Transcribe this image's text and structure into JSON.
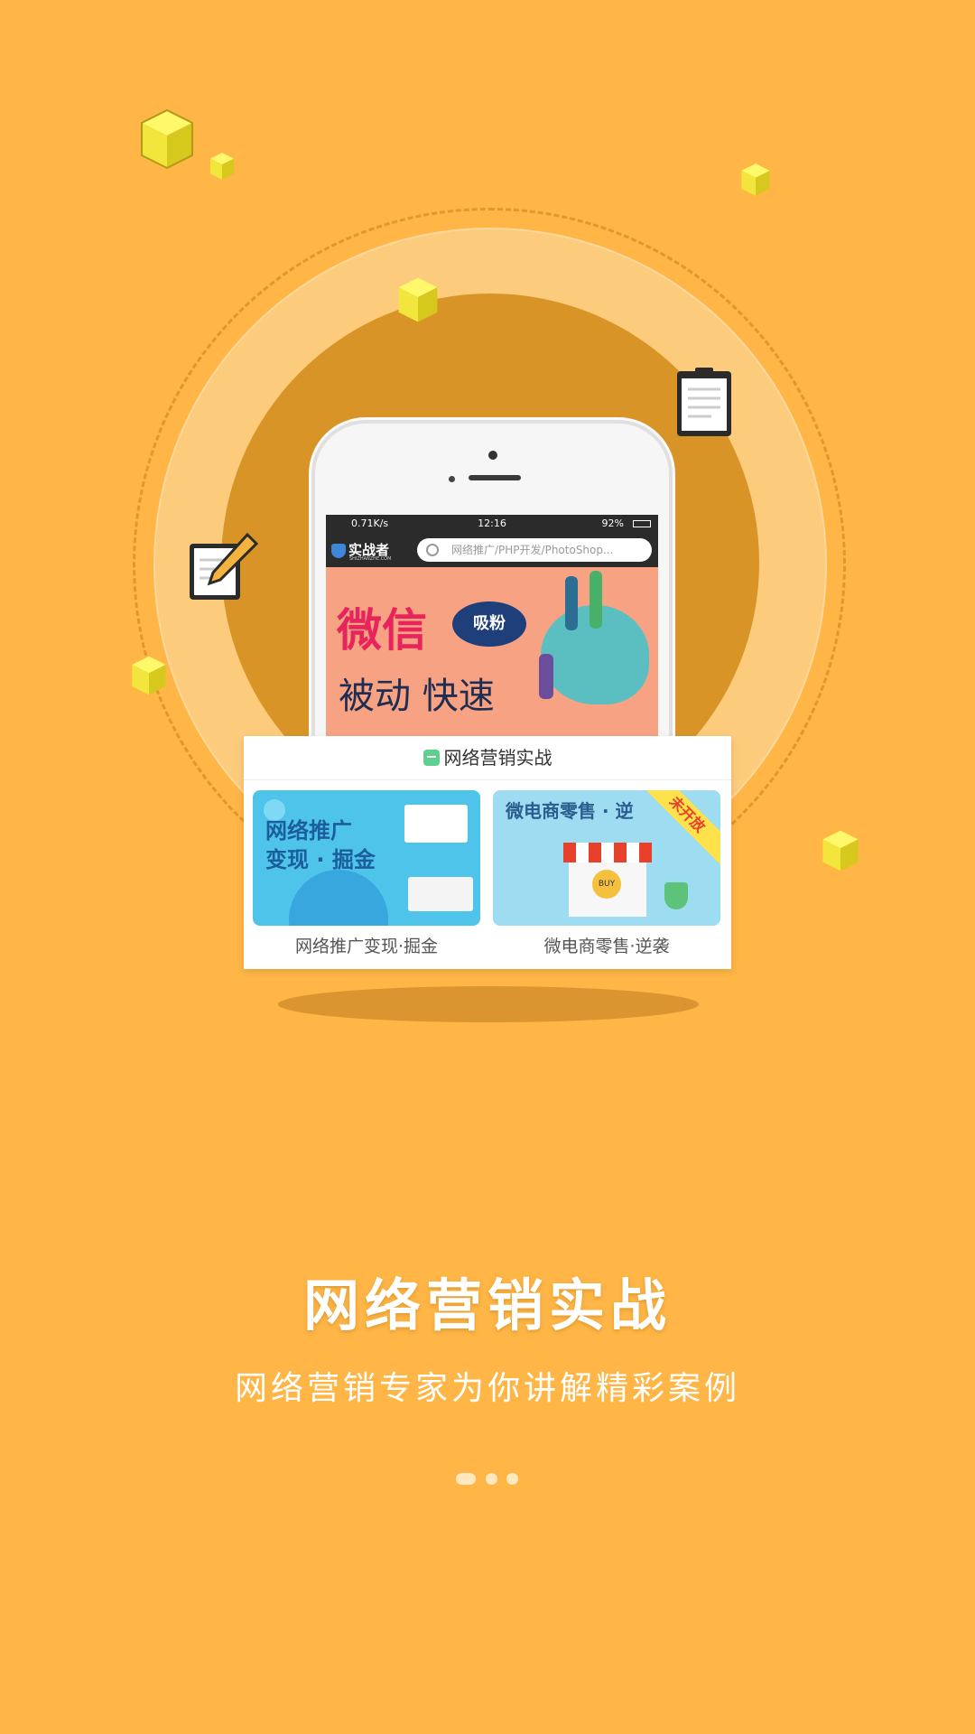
{
  "phone": {
    "status": {
      "left": "0.71K/s",
      "time": "12:16",
      "battery": "92%"
    },
    "app_name": "实战者",
    "app_domain": "SHIZHANZHE.COM",
    "search_placeholder": "网络推广/PHP开发/PhotoShop...",
    "banner": {
      "line1": "微信",
      "badge": "吸粉",
      "line2": "被动 快速"
    }
  },
  "card": {
    "title": "网络营销实战",
    "items": [
      {
        "thumb_text_1": "网络推广",
        "thumb_text_2": "变现 · 掘金",
        "caption": "网络推广变现·掘金"
      },
      {
        "thumb_text_1": "微电商零售 · 逆",
        "ribbon": "未开放",
        "caption": "微电商零售·逆袭"
      }
    ]
  },
  "title": "网络营销实战",
  "subtitle": "网络营销专家为你讲解精彩案例",
  "pager": {
    "count": 3,
    "active": 1
  },
  "colors": {
    "background": "#FFB646",
    "inner_circle": "#D99428",
    "accent_pink": "#E8245C"
  }
}
